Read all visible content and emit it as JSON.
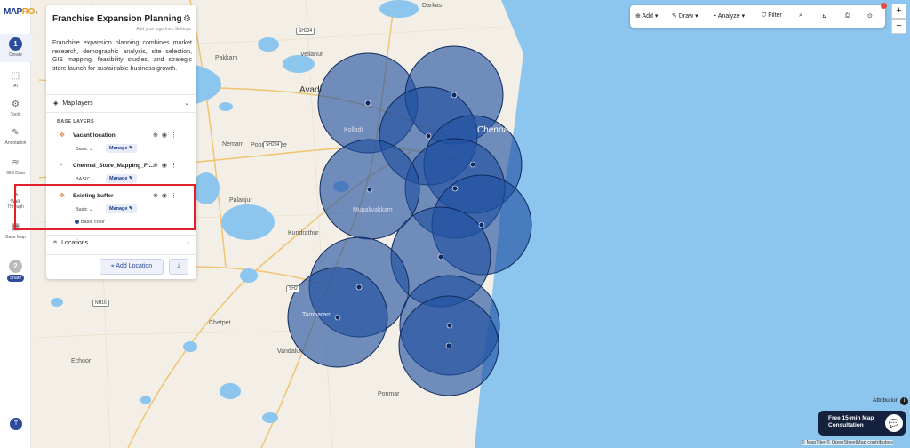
{
  "app": {
    "logo_main": "MAP",
    "logo_accent": "RO"
  },
  "rail": {
    "items": [
      {
        "label": "Create",
        "step": "1"
      },
      {
        "label": "AI"
      },
      {
        "label": "Tools"
      },
      {
        "label": "Annotation"
      },
      {
        "label": "GIS Data"
      },
      {
        "label": "Walk Through"
      },
      {
        "label": "Base Map"
      },
      {
        "label": "Share",
        "step": "2"
      }
    ],
    "avatar": "T"
  },
  "panel": {
    "title": "Franchise Expansion Planning",
    "subtitle": "Add your logo from Settings",
    "description": "Franchise expansion planning combines market research, demographic analysis, site selection, GIS mapping, feasibility studies, and strategic store launch for sustainable business growth.",
    "map_layers_label": "Map layers",
    "base_layers_label": "BASE LAYERS",
    "layers": [
      {
        "name": "Vacant location",
        "style": "Basic",
        "manage": "Manage"
      },
      {
        "name": "Chennai_Store_Mapping_Fi...",
        "style": "BASIC",
        "manage": "Manage"
      },
      {
        "name": "Existing buffer",
        "style": "Basic",
        "manage": "Manage",
        "color_label": "Basic color"
      }
    ],
    "locations_label": "Locations",
    "add_location_label": "Add Location"
  },
  "toolbar": {
    "add": "Add",
    "draw": "Draw",
    "analyze": "Analyze",
    "filter": "Filter"
  },
  "map": {
    "labels": {
      "avadi": "Avadi",
      "chennai": "Chennai",
      "poonamallee": "Poonamallee",
      "kundrathur": "Kundrathur",
      "tambaram": "Tambaram",
      "vandalur": "Vandalur",
      "pakkam": "Pakkam",
      "vellanur": "Vellanur",
      "nemam": "Nemam",
      "palanjur": "Palanjur",
      "chetpet": "Chetpet",
      "echoor": "Echoor",
      "ponmar": "Ponmar",
      "kolladi": "Kolladi",
      "mugalivakkam": "Mugalivakkam",
      "darkas": "Darkas",
      "sh234a": "SH234",
      "sh234b": "SH234",
      "nh16": "NH16",
      "sh2": "SH2"
    },
    "buffer_color": "#1f4fa0",
    "water_color": "#8cc5ee",
    "land_color": "#f3efe6"
  },
  "footer": {
    "attribution": "Attribution",
    "consultation_line1": "Free 15-min Map",
    "consultation_line2": "Consultation",
    "credits": "© MapTiler © OpenStreetMap contributors"
  }
}
